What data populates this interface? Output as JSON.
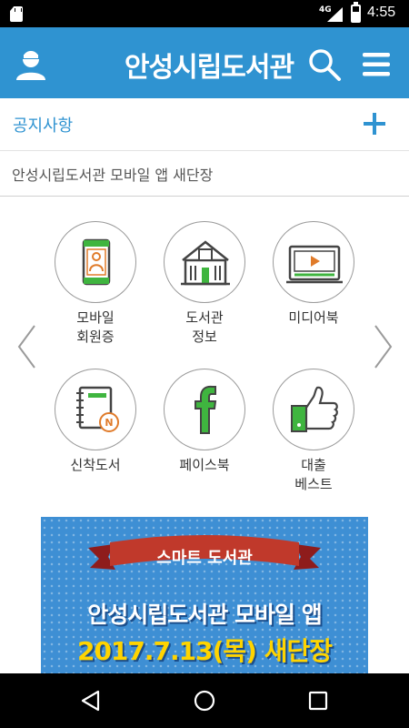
{
  "status_bar": {
    "network": "4G",
    "time": "4:55"
  },
  "app_bar": {
    "title": "안성시립도서관"
  },
  "notice": {
    "header_label": "공지사항",
    "items": [
      "안성시립도서관 모바일 앱 새단장"
    ]
  },
  "menu": {
    "items": [
      {
        "label": "모바일\n회원증",
        "icon": "mobile-card-icon"
      },
      {
        "label": "도서관\n정보",
        "icon": "library-building-icon"
      },
      {
        "label": "미디어북",
        "icon": "media-player-icon"
      },
      {
        "label": "신착도서",
        "icon": "new-book-icon"
      },
      {
        "label": "페이스북",
        "icon": "facebook-icon"
      },
      {
        "label": "대출\n베스트",
        "icon": "thumbs-up-icon"
      }
    ]
  },
  "banner": {
    "ribbon_text": "스마트 도서관",
    "line1": "안성시립도서관 모바일 앱",
    "line2": "2017.7.13(목) 새단장"
  },
  "colors": {
    "primary": "#2f93d1",
    "accent_green": "#3fb53f",
    "banner_yellow": "#ffd400",
    "ribbon_red": "#c0392b"
  }
}
